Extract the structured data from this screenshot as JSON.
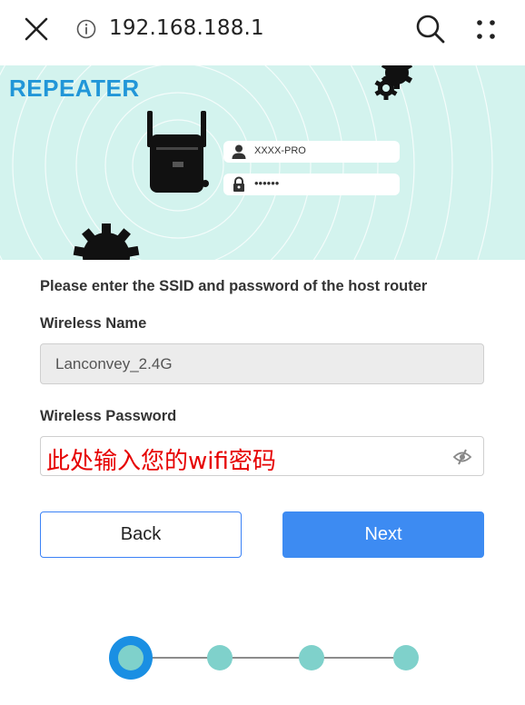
{
  "browser": {
    "url": "192.168.188.1"
  },
  "banner": {
    "title": "REPEATER",
    "ssid_example": "XXXX-PRO",
    "password_example": "••••••"
  },
  "form": {
    "instruction": "Please enter the SSID and password of the host router",
    "wireless_name_label": "Wireless Name",
    "wireless_name_value": "Lanconvey_2.4G",
    "wireless_password_label": "Wireless Password",
    "wireless_password_hint": "此处输入您的wifi密码"
  },
  "buttons": {
    "back": "Back",
    "next": "Next"
  },
  "stepper": {
    "total_steps": 4,
    "current_step": 1
  },
  "colors": {
    "accent": "#3d8bf2",
    "banner_bg": "#d3f3ee",
    "banner_title": "#2196d8",
    "step_dot": "#7fd1cb",
    "hint_red": "#e60000"
  }
}
